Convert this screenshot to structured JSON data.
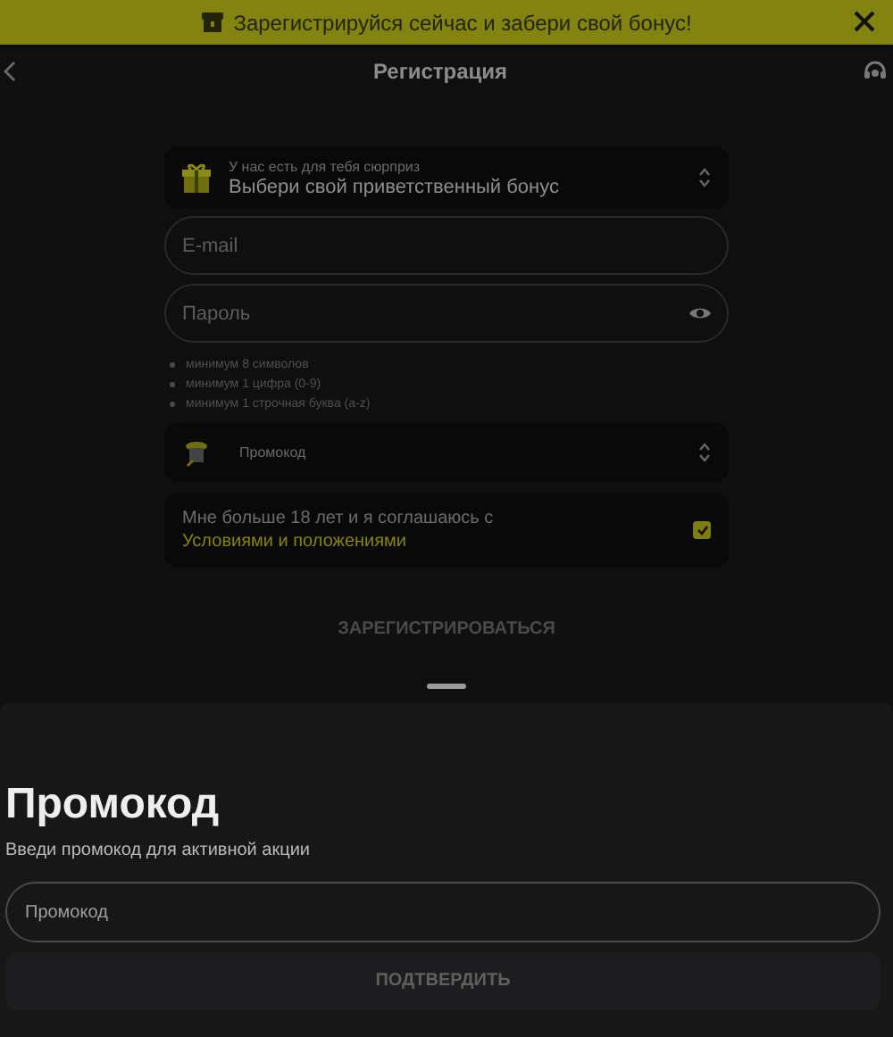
{
  "banner": {
    "text": "Зарегистрируйся сейчас и забери свой бонус!"
  },
  "header": {
    "title": "Регистрация"
  },
  "bonus_select": {
    "caption": "У нас есть для тебя сюрприз",
    "value": "Выбери свой приветственный бонус"
  },
  "fields": [
    {
      "placeholder": "E-mail",
      "kind": "text"
    },
    {
      "placeholder": "Пароль",
      "kind": "password"
    }
  ],
  "password_rules": [
    "минимум 8 символов",
    "минимум 1 цифра (0-9)",
    "минимум 1 строчная буква (a-z)"
  ],
  "promo_select": {
    "label": "Промокод"
  },
  "terms": {
    "text": "Мне больше 18 лет и я соглашаюсь с",
    "link": "Условиями и положениями",
    "checked": true
  },
  "register_button": {
    "label": "ЗАРЕГИСТРИРОВАТЬСЯ",
    "disabled": true
  },
  "promo_sheet": {
    "title": "Промокод",
    "subtitle": "Введи промокод для активной акции",
    "field": {
      "placeholder": "Промокод"
    },
    "confirm_button": {
      "label": "ПОДТВЕРДИТЬ",
      "disabled": true
    }
  }
}
